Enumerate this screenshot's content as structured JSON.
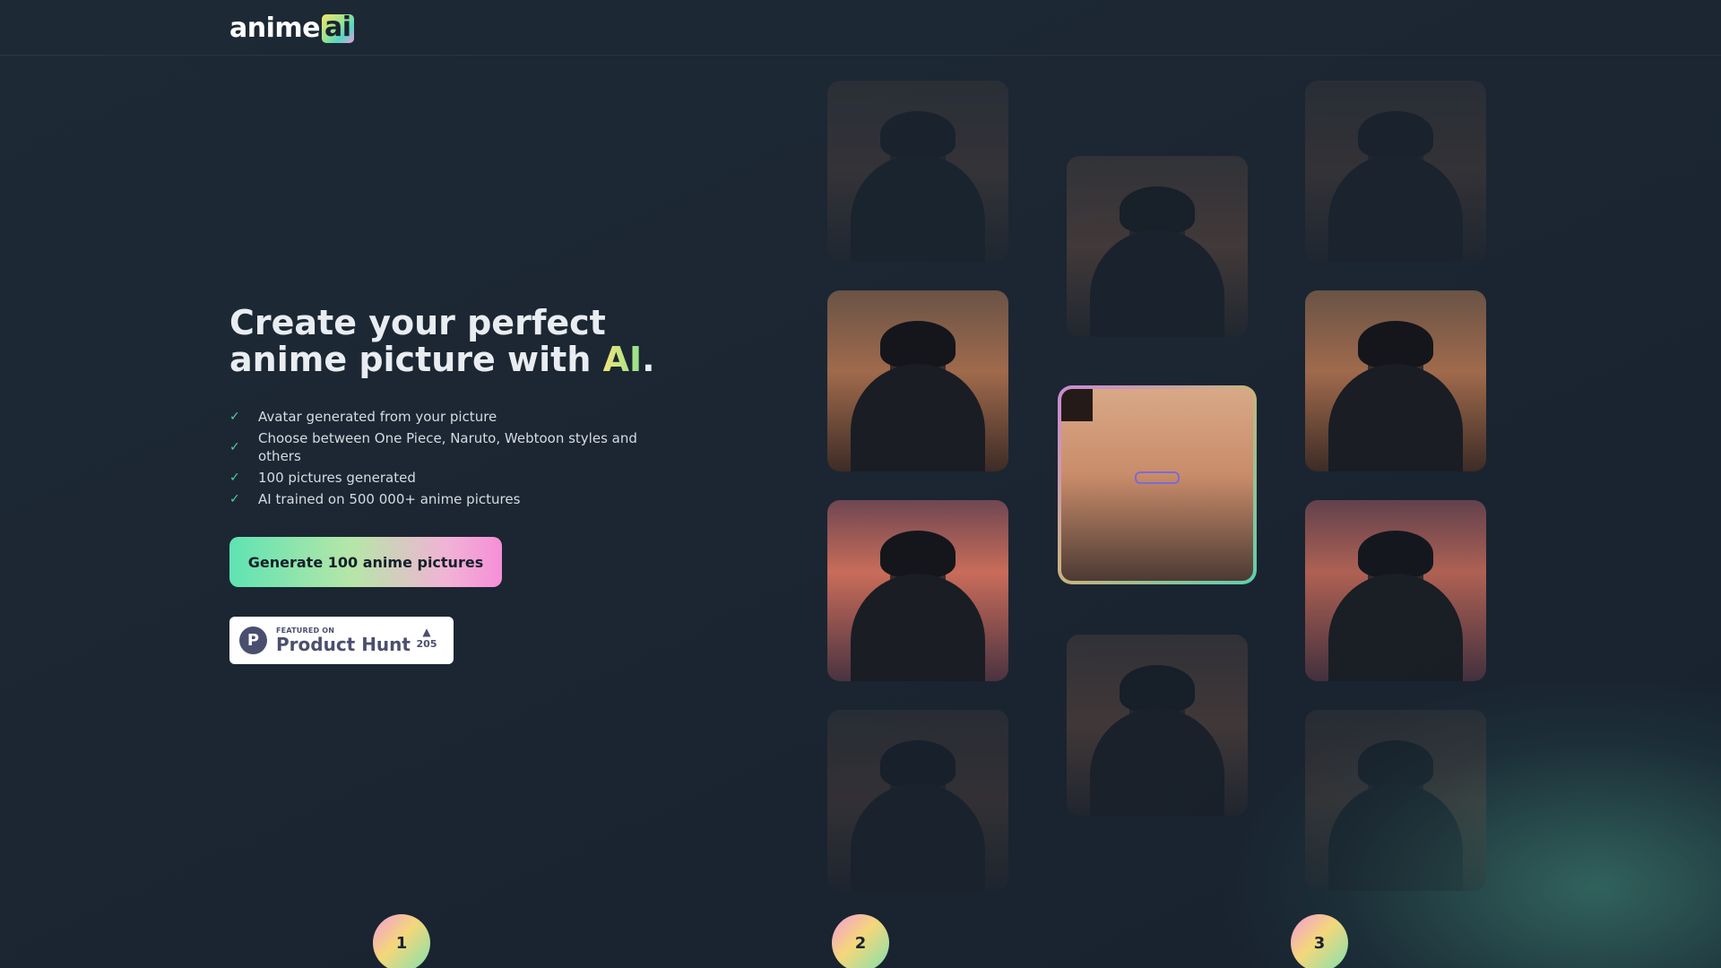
{
  "navbar": {
    "logo_word": "anime",
    "logo_badge": "ai"
  },
  "hero": {
    "title_line1": "Create your perfect",
    "title_line2_prefix": "anime picture with ",
    "title_highlight": "AI",
    "title_suffix": ".",
    "features": [
      "Avatar generated from your picture",
      "Choose between One Piece, Naruto, Webtoon styles and others",
      "100 pictures generated",
      "AI trained on 500 000+ anime pictures"
    ],
    "cta_label": "Generate 100 anime pictures"
  },
  "product_hunt": {
    "featured_on": "FEATURED ON",
    "name": "Product Hunt",
    "votes": "205",
    "logo_letter": "P"
  },
  "steps": [
    "1",
    "2",
    "3"
  ],
  "colors": {
    "background": "#1a2430",
    "check": "#4fd19a",
    "cta_gradient_start": "#5fe3b3",
    "cta_gradient_end": "#f58fd8"
  }
}
